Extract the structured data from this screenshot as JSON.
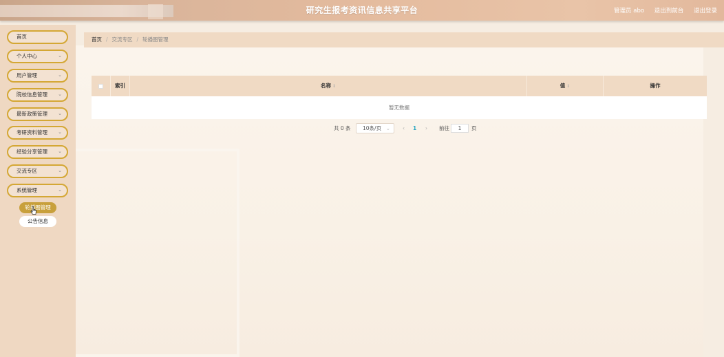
{
  "header": {
    "title": "研究生报考资讯信息共享平台",
    "admin_label": "管理员 abo",
    "back_to_front": "退出到前台",
    "logout": "退出登录"
  },
  "sidebar": {
    "items": [
      {
        "label": "首页",
        "has_arrow": false
      },
      {
        "label": "个人中心",
        "has_arrow": true
      },
      {
        "label": "用户管理",
        "has_arrow": true
      },
      {
        "label": "院校信息管理",
        "has_arrow": true
      },
      {
        "label": "最新政策管理",
        "has_arrow": true
      },
      {
        "label": "考研资料管理",
        "has_arrow": true
      },
      {
        "label": "经验分享管理",
        "has_arrow": true
      },
      {
        "label": "交流专区",
        "has_arrow": true
      },
      {
        "label": "系统管理",
        "has_arrow": true
      }
    ],
    "sub_items": [
      {
        "label": "轮播图管理",
        "active": true
      },
      {
        "label": "公告信息",
        "active": false
      }
    ],
    "arrow": "⌄"
  },
  "breadcrumb": {
    "home": "首页",
    "level1": "交流专区",
    "level2": "轮播图管理",
    "sep": "/"
  },
  "table": {
    "headers": {
      "index": "索引",
      "name": "名称",
      "value": "值",
      "ops": "操作"
    },
    "sort_icon": "⇕",
    "empty_text": "暂无数据"
  },
  "pager": {
    "total": "共 0 条",
    "size": "10条/页",
    "prev": "‹",
    "page": "1",
    "next": "›",
    "goto": "前往",
    "goto_value": "1",
    "unit": "页"
  }
}
